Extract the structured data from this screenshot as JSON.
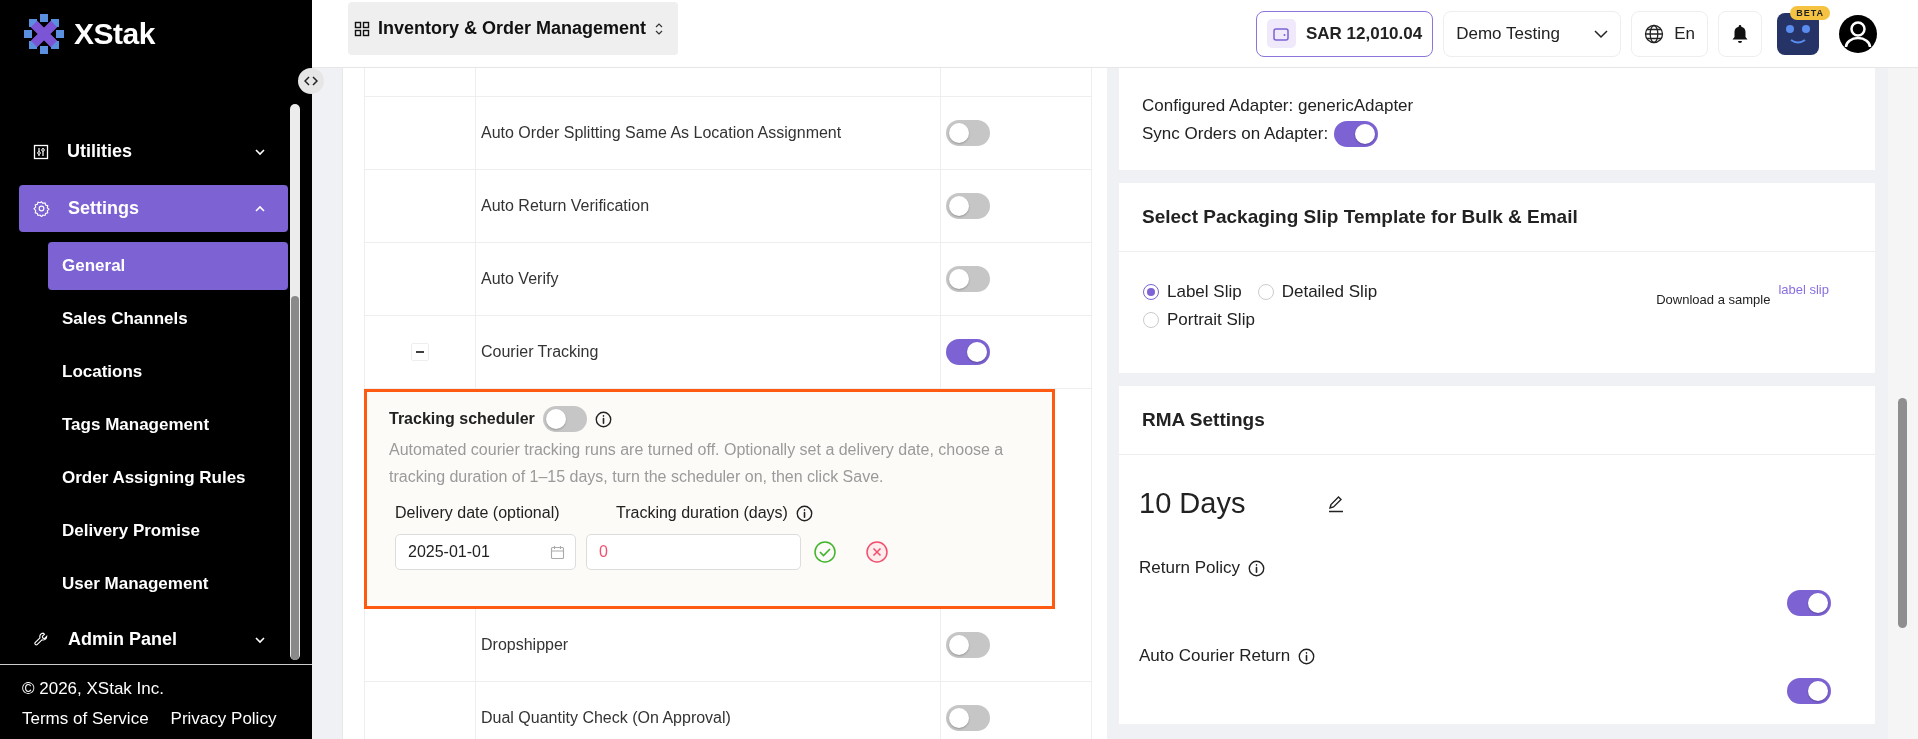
{
  "sidebar": {
    "logo": "XStak",
    "items": [
      {
        "label": "Utilities",
        "kind": "utilities",
        "expanded": false,
        "selected": false
      },
      {
        "label": "Settings",
        "kind": "settings",
        "expanded": true,
        "selected": true,
        "children": [
          {
            "label": "General",
            "selected": true
          },
          {
            "label": "Sales Channels",
            "selected": false
          },
          {
            "label": "Locations",
            "selected": false
          },
          {
            "label": "Tags Management",
            "selected": false
          },
          {
            "label": "Order Assigning Rules",
            "selected": false
          },
          {
            "label": "Delivery Promise",
            "selected": false
          },
          {
            "label": "User Management",
            "selected": false
          }
        ]
      },
      {
        "label": "Admin Panel",
        "kind": "admin",
        "expanded": false,
        "selected": false
      }
    ],
    "footer": {
      "copyright": "© 2026, XStak Inc.",
      "links": [
        "Terms of Service",
        "Privacy Policy"
      ]
    }
  },
  "header": {
    "app_switcher": "Inventory & Order Management",
    "balance": "SAR 12,010.04",
    "store": "Demo Testing",
    "language": "En",
    "assistant_badge": "BETA"
  },
  "settings_table": {
    "rows": [
      {
        "label": "Auto Order Splitting Same As Location Assignment",
        "on": false
      },
      {
        "label": "Auto Return Verification",
        "on": false
      },
      {
        "label": "Auto Verify",
        "on": false
      },
      {
        "label": "Courier Tracking",
        "on": true,
        "expanded": true
      },
      {
        "label": "Dropshipper",
        "on": false
      },
      {
        "label": "Dual Quantity Check (On Approval)",
        "on": false
      }
    ],
    "tracking_scheduler": {
      "title": "Tracking scheduler",
      "on": false,
      "description": "Automated courier tracking runs are turned off. Optionally set a delivery date, choose a tracking duration of 1–15 days, turn the scheduler on, then click Save.",
      "delivery_date_label": "Delivery date (optional)",
      "delivery_date": "2025-01-01",
      "duration_label": "Tracking duration (days)",
      "duration": "0",
      "duration_invalid": true
    }
  },
  "adapter": {
    "configured": "Configured Adapter: genericAdapter",
    "sync_label": "Sync Orders on Adapter:",
    "sync_on": true
  },
  "packaging_slip": {
    "title": "Select Packaging Slip Template for Bulk & Email",
    "options": [
      {
        "label": "Label Slip",
        "selected": true
      },
      {
        "label": "Detailed Slip",
        "selected": false
      },
      {
        "label": "Portrait Slip",
        "selected": false
      }
    ],
    "sample_text": "Download a sample",
    "sample_link": "label slip"
  },
  "rma": {
    "title": "RMA Settings",
    "days": "10 Days",
    "settings": [
      {
        "label": "Return Policy",
        "on": true
      },
      {
        "label": "Auto Courier Return",
        "on": true
      }
    ]
  }
}
